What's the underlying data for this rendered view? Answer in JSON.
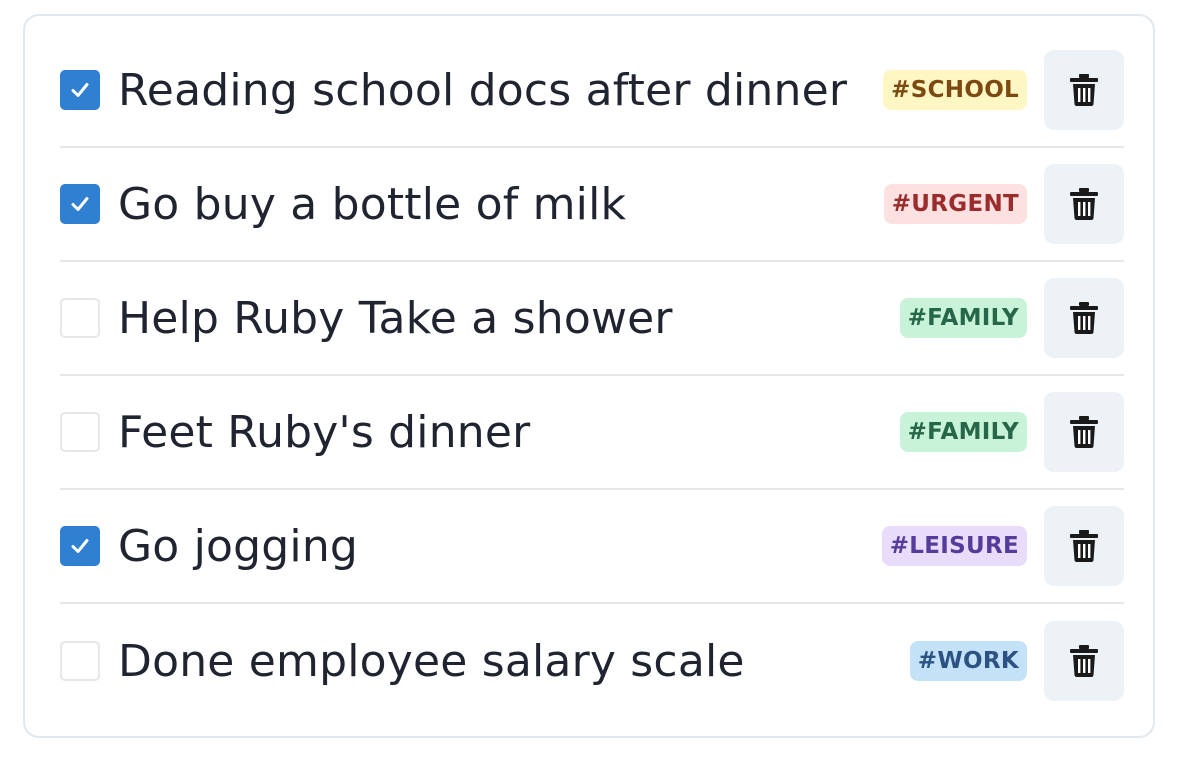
{
  "todos": [
    {
      "label": "Reading school docs after dinner",
      "checked": true,
      "tag": "#SCHOOL",
      "tag_bg": "#fef6c3",
      "tag_fg": "#7c4a10"
    },
    {
      "label": "Go buy a bottle of milk",
      "checked": true,
      "tag": "#URGENT",
      "tag_bg": "#fde0e0",
      "tag_fg": "#9b2c2c"
    },
    {
      "label": "Help Ruby Take a shower",
      "checked": false,
      "tag": "#FAMILY",
      "tag_bg": "#c9f3d9",
      "tag_fg": "#276749"
    },
    {
      "label": "Feet Ruby's dinner",
      "checked": false,
      "tag": "#FAMILY",
      "tag_bg": "#c9f3d9",
      "tag_fg": "#276749"
    },
    {
      "label": "Go jogging",
      "checked": true,
      "tag": "#LEISURE",
      "tag_bg": "#e9dcfb",
      "tag_fg": "#553c9a"
    },
    {
      "label": "Done employee salary scale",
      "checked": false,
      "tag": "#WORK",
      "tag_bg": "#c3e2f8",
      "tag_fg": "#2c5282"
    }
  ],
  "colors": {
    "checkbox_checked": "#2f80d1",
    "delete_button_bg": "#edf2f7",
    "icon": "#1a1a1a"
  },
  "icons": {
    "check": "check-icon",
    "delete": "trash-icon"
  }
}
